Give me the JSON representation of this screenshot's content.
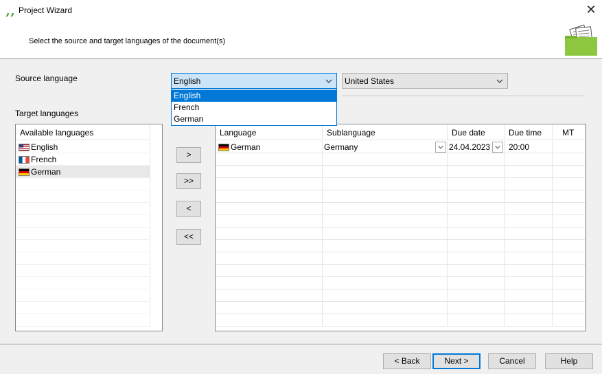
{
  "window": {
    "title": "Project Wizard",
    "subtitle": "Select the source and target languages of the document(s)",
    "close_glyph": "✕"
  },
  "source": {
    "label": "Source language",
    "language_value": "English",
    "region_value": "United States",
    "dropdown_options": [
      "English",
      "French",
      "German"
    ]
  },
  "target": {
    "label": "Target languages",
    "available_header": "Available languages",
    "available": [
      "English",
      "French",
      "German"
    ]
  },
  "transfer_buttons": [
    ">",
    ">>",
    "<",
    "<<"
  ],
  "grid": {
    "headers": [
      "Language",
      "Sublanguage",
      "Due date",
      "Due time",
      "MT"
    ],
    "rows": [
      {
        "language": "German",
        "sublanguage": "Germany",
        "due_date": "24.04.2023",
        "due_time": "20:00",
        "mt": ""
      }
    ]
  },
  "footer": {
    "back": "< Back",
    "next": "Next >",
    "cancel": "Cancel",
    "help": "Help"
  },
  "colors": {
    "accent": "#0078d7",
    "selection_bg": "#cce4f7",
    "header_folder": "#8dc63f",
    "logo_green": "#5a9e3a"
  },
  "icons": {
    "app": "quote-logo-icon",
    "close": "close-icon",
    "dropdown": "chevron-down-icon",
    "header": "folder-documents-icon"
  }
}
